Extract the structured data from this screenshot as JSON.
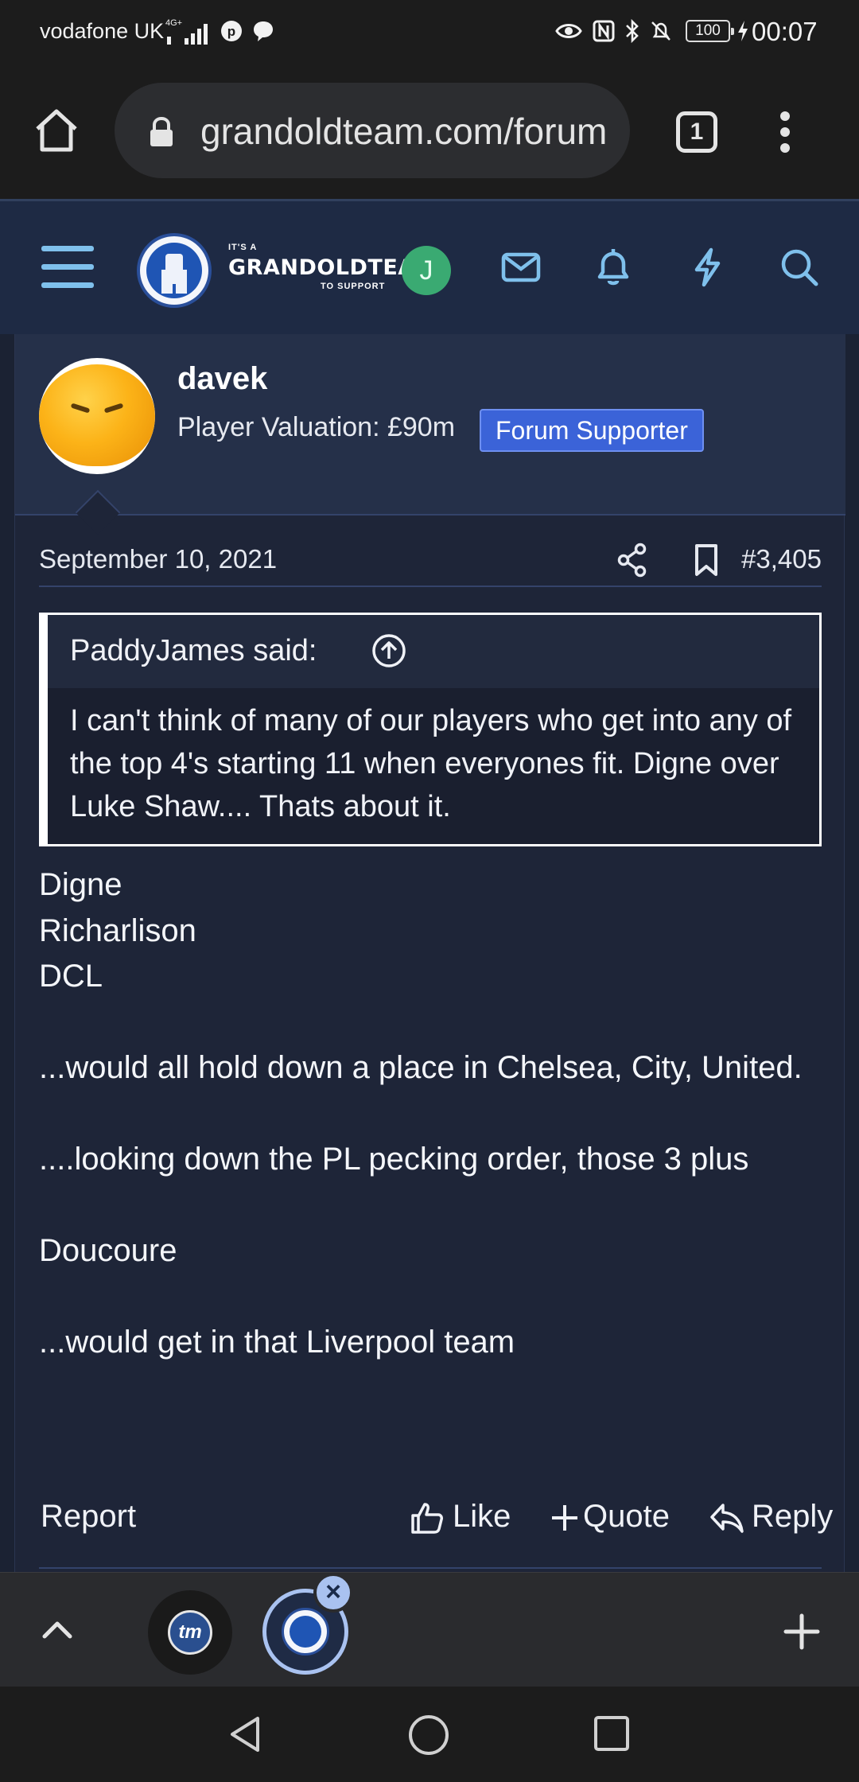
{
  "status_bar": {
    "carrier": "vodafone UK",
    "network": "4G+",
    "battery": "100",
    "time": "00:07"
  },
  "browser": {
    "url": "grandoldteam.com/forum",
    "tab_count": "1"
  },
  "site_header": {
    "logo_small_top": "IT'S A",
    "logo_main": "GRANDOLDTEAM",
    "logo_small_bottom": "TO SUPPORT",
    "user_initial": "J"
  },
  "post": {
    "username": "davek",
    "valuation": "Player Valuation: £90m",
    "badge": "Forum Supporter",
    "date": "September 10, 2021",
    "post_number": "#3,405",
    "quote": {
      "author": "PaddyJames said:",
      "text": "I can't think of many of our players who get into any of the top 4's starting 11 when everyones fit. Digne over Luke Shaw.... Thats about it."
    },
    "body": {
      "line1": "Digne",
      "line2": "Richarlison",
      "line3": "DCL",
      "line5": "...would all hold down a place in Chelsea, City, United.",
      "line7": "....looking down the PL pecking order, those 3 plus",
      "line9": "Doucoure",
      "line11": "...would get in that Liverpool team"
    },
    "actions": {
      "report": "Report",
      "like": "Like",
      "quote": "Quote",
      "reply": "Reply"
    }
  },
  "tab_strip": {
    "tab1_label": "tm"
  },
  "colors": {
    "page_bg": "#1b2233",
    "header_bg": "#1e2a44",
    "badge_bg": "#3b63d8",
    "avatar_j": "#3aaa72",
    "icon_blue": "#7fc0ec"
  }
}
